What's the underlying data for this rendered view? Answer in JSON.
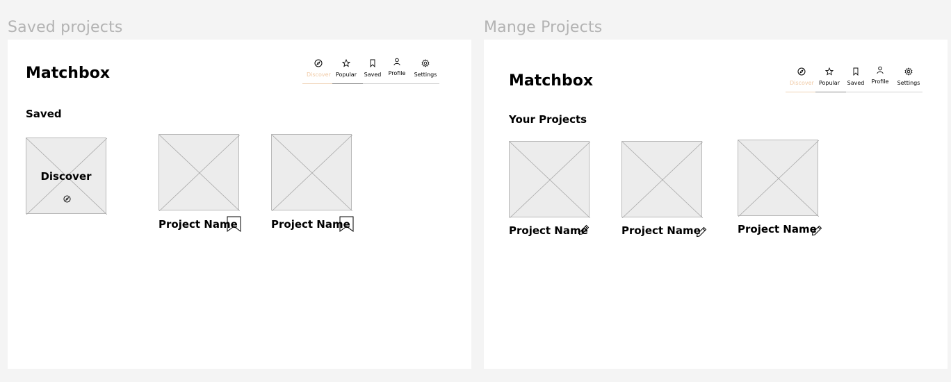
{
  "frames": [
    {
      "title": "Saved projects",
      "logo": "Matchbox",
      "section": "Saved",
      "discover_card": {
        "label": "Discover",
        "icon": "compass-icon"
      },
      "projects": [
        {
          "name": "Project Name",
          "icon": "bookmark-icon"
        },
        {
          "name": "Project Name",
          "icon": "bookmark-icon"
        }
      ]
    },
    {
      "title": "Mange Projects",
      "logo": "Matchbox",
      "section": "Your Projects",
      "projects": [
        {
          "name": "Project Name",
          "icon": "pencil-icon"
        },
        {
          "name": "Project Name",
          "icon": "pencil-icon"
        },
        {
          "name": "Project Name",
          "icon": "pencil-icon"
        }
      ]
    }
  ],
  "nav": [
    {
      "label": "Discover",
      "icon": "compass-icon",
      "active": true
    },
    {
      "label": "Popular",
      "icon": "star-icon"
    },
    {
      "label": "Saved",
      "icon": "bookmark-icon"
    },
    {
      "label": "Profile",
      "icon": "user-icon"
    },
    {
      "label": "Settings",
      "icon": "gear-icon"
    }
  ],
  "colors": {
    "background": "#f4f4f4",
    "frame": "#ffffff",
    "active_nav": "#f0c9a4",
    "placeholder": "#ececec"
  }
}
